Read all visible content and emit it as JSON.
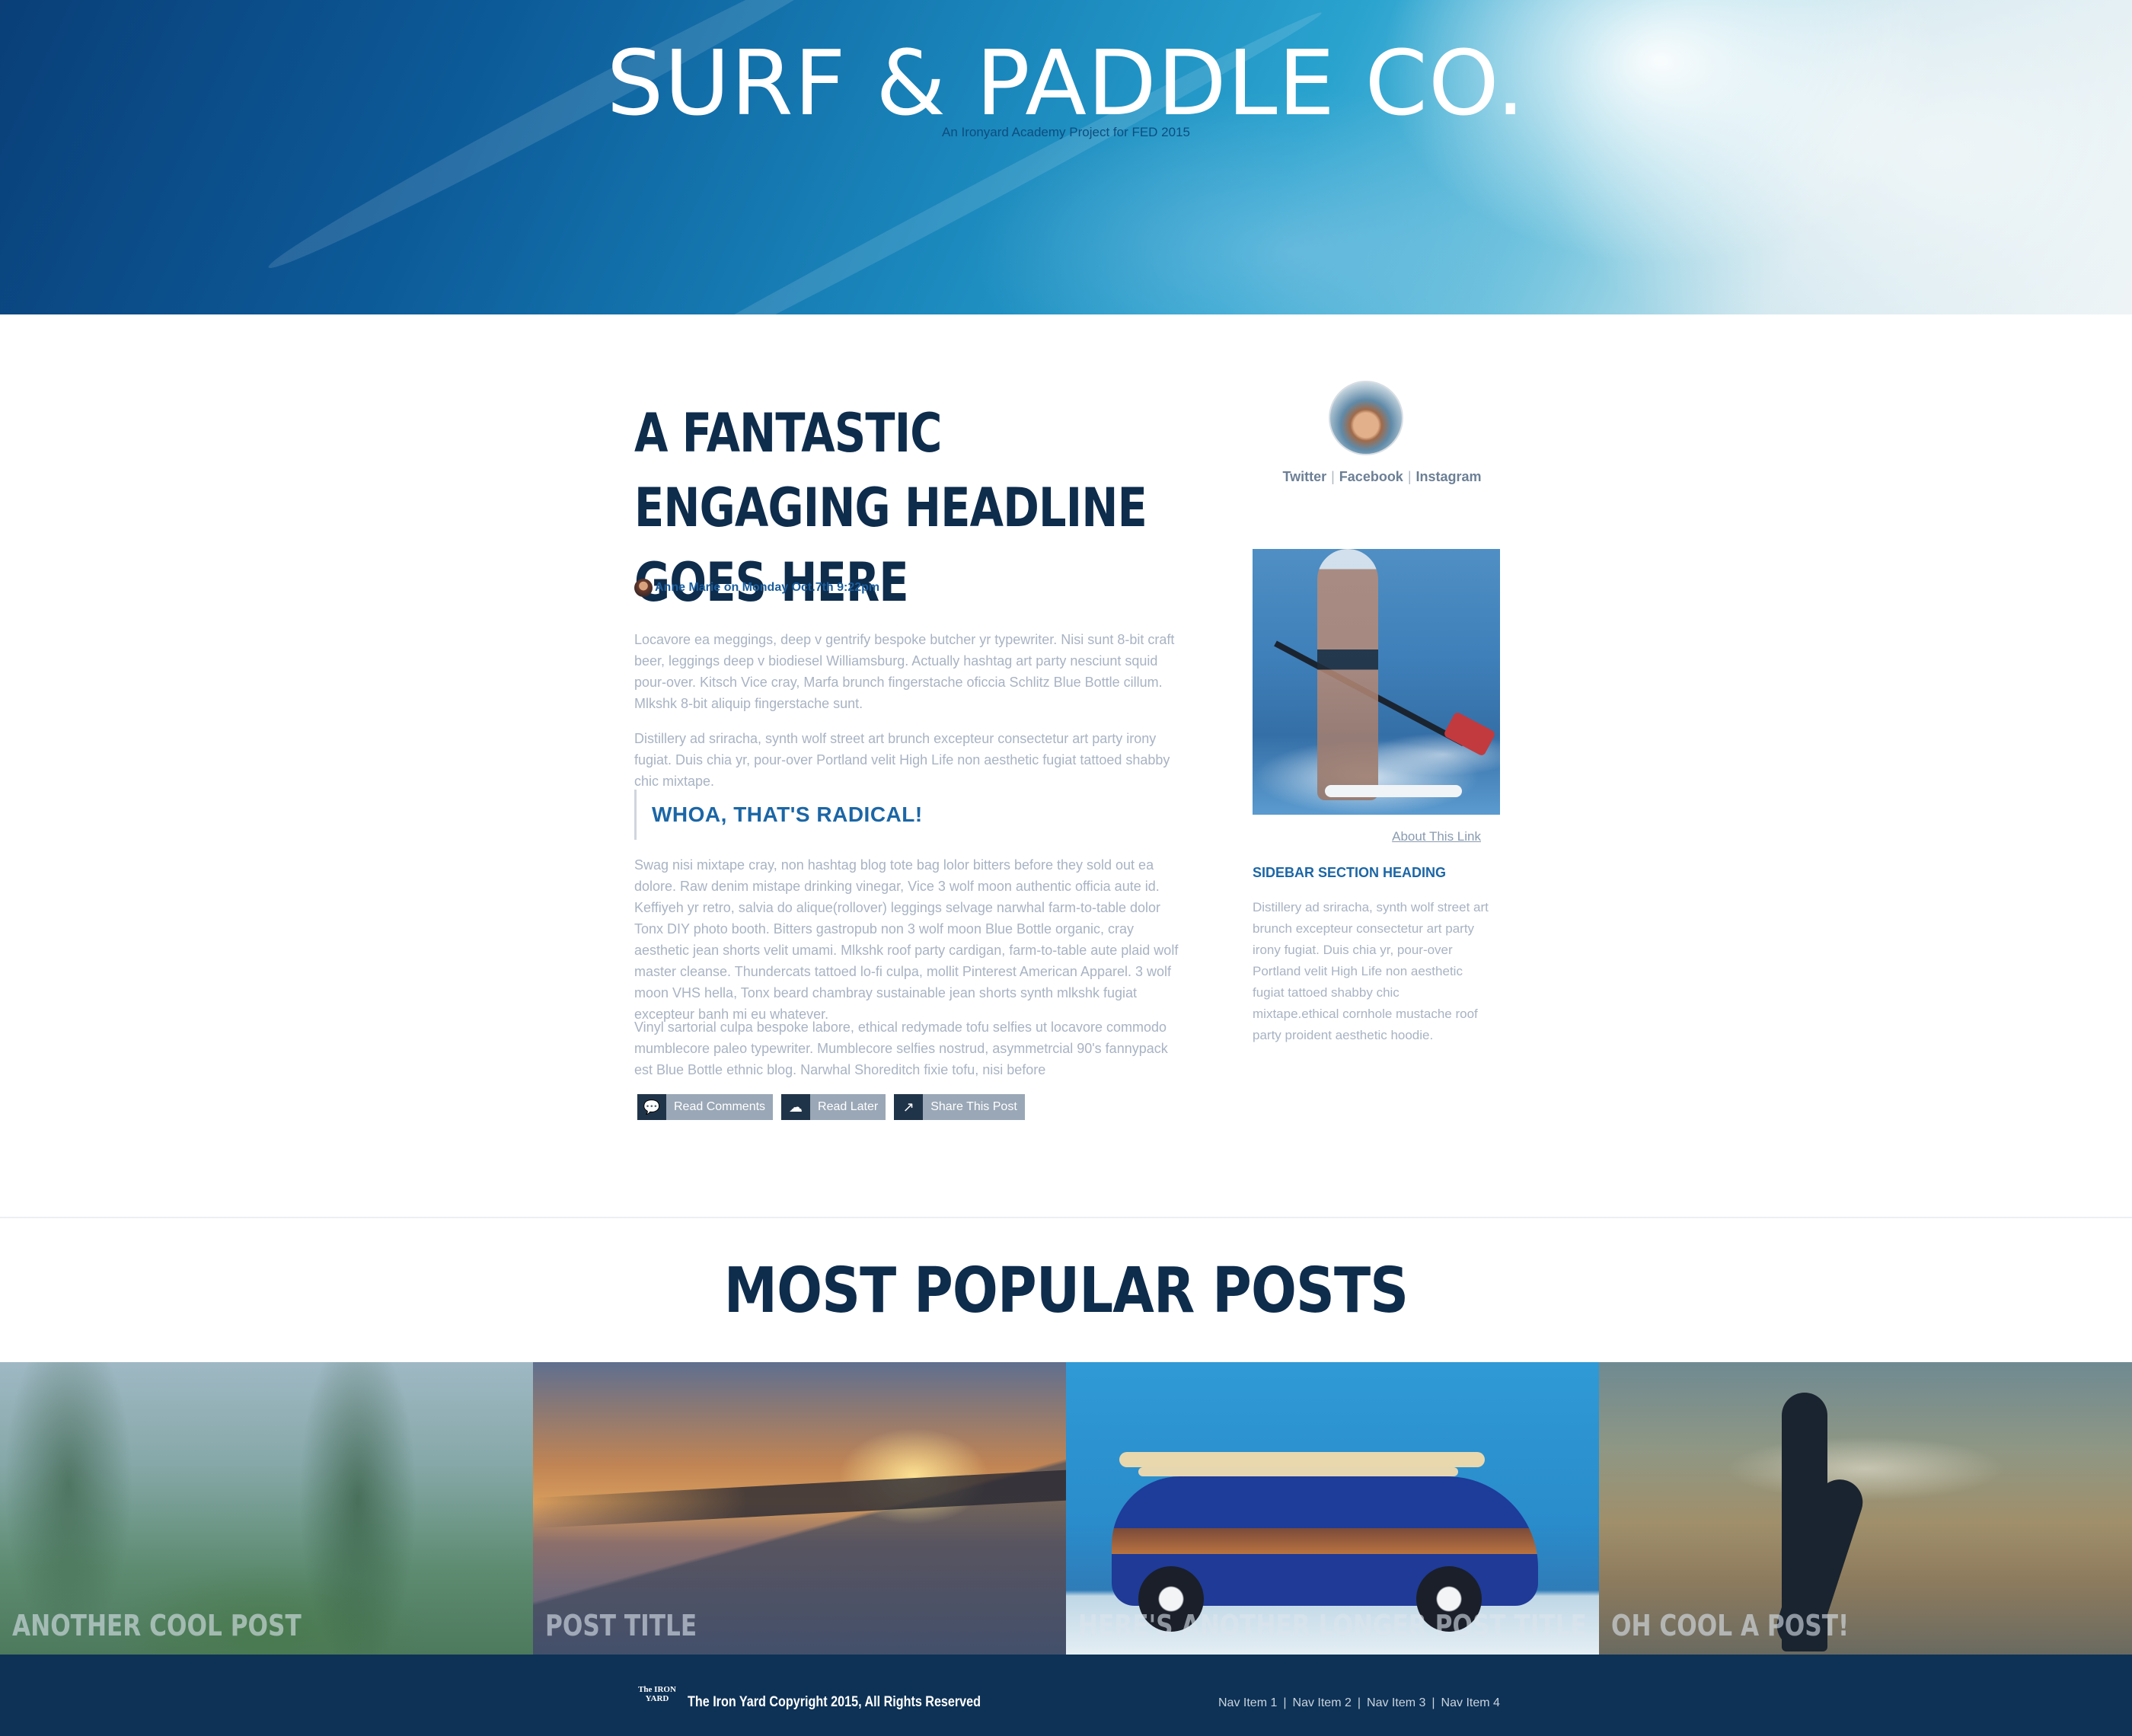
{
  "header": {
    "title": "SURF & PADDLE CO.",
    "subtitle": "An Ironyard Academy Project for FED 2015"
  },
  "article": {
    "headline": "A FANTASTIC ENGAGING HEADLINE GOES HERE",
    "byline": "Anne Marie on Monday Oct.7th 9:22pm",
    "para1": "Locavore ea meggings, deep v gentrify bespoke butcher yr typewriter. Nisi sunt 8-bit craft beer, leggings deep v biodiesel Williamsburg. Actually hashtag art party nesciunt squid pour-over. Kitsch Vice cray, Marfa brunch fingerstache oficcia Schlitz Blue Bottle cillum. Mlkshk 8-bit aliquip fingerstache sunt.",
    "para2": "Distillery ad sriracha, synth wolf street art brunch excepteur consectetur art party irony fugiat. Duis chia yr, pour-over Portland velit High Life non aesthetic fugiat tattoed shabby chic mixtape.",
    "pull_quote": "WHOA, THAT'S RADICAL!",
    "para3": "Swag nisi mixtape cray, non hashtag blog tote bag lolor bitters before they sold out ea dolore. Raw denim mistape drinking vinegar, Vice 3 wolf moon authentic officia aute id. Keffiyeh yr retro, salvia do alique(rollover) leggings selvage narwhal farm-to-table dolor Tonx DIY photo booth. Bitters gastropub non 3 wolf moon Blue Bottle organic, cray aesthetic jean shorts velit umami. Mlkshk roof party cardigan, farm-to-table aute plaid wolf master cleanse. Thundercats tattoed lo-fi culpa, mollit Pinterest American Apparel. 3 wolf moon VHS hella, Tonx beard chambray sustainable jean shorts synth mlkshk fugiat excepteur banh mi eu whatever.",
    "para4": "Vinyl sartorial culpa bespoke labore, ethical redymade tofu selfies ut locavore commodo mumblecore paleo typewriter. Mumblecore selfies nostrud, asymmetrcial 90's fannypack est Blue Bottle ethnic blog. Narwhal Shoreditch fixie tofu, nisi before",
    "actions": [
      {
        "icon": "comment-icon",
        "glyph": "💬",
        "label": "Read Comments"
      },
      {
        "icon": "cloud-download-icon",
        "glyph": "☁",
        "label": "Read Later"
      },
      {
        "icon": "share-icon",
        "glyph": "↗",
        "label": "Share This Post"
      }
    ]
  },
  "sidebar": {
    "social": [
      "Twitter",
      "Facebook",
      "Instagram"
    ],
    "about_link": "About This Link",
    "heading": "SIDEBAR SECTION HEADING",
    "text": "Distillery ad sriracha, synth wolf street art brunch excepteur consectetur art party irony fugiat. Duis chia yr, pour-over Portland velit High Life non aesthetic fugiat tattoed shabby chic mixtape.ethical cornhole mustache roof party proident aesthetic hoodie."
  },
  "popular": {
    "title": "MOST POPULAR POSTS",
    "posts": [
      "ANOTHER COOL POST",
      "POST TITLE",
      "HERE'S ANOTHER LONGER POST TITLE",
      "OH COOL A POST!"
    ]
  },
  "footer": {
    "logo_text": "The IRON YARD",
    "copyright": "The Iron Yard Copyright 2015, All Rights Reserved",
    "nav": [
      "Nav Item 1",
      "Nav Item 2",
      "Nav Item 3",
      "Nav Item 4"
    ]
  },
  "colors": {
    "navy": "#0e2c4c",
    "accent_blue": "#1b66a6",
    "footer_bg": "#0e3256",
    "body_text": "#a8b3c3"
  }
}
